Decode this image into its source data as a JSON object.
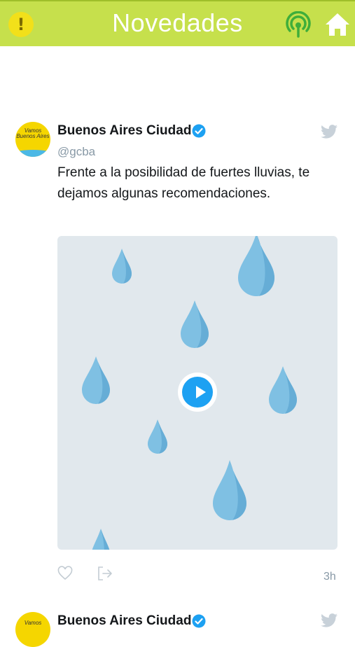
{
  "header": {
    "title": "Novedades",
    "alert_symbol": "!",
    "accent": "#c6e04c"
  },
  "tweets": [
    {
      "account_name": "Buenos Aires Ciudad",
      "handle": "@gcba",
      "avatar_text": "Vamos Buenos Aires",
      "text": "Frente a la posibilidad de fuertes lluvias, te dejamos algunas recomendaciones.",
      "time": "3h"
    },
    {
      "account_name": "Buenos Aires Ciudad",
      "avatar_text": "Vamos"
    }
  ]
}
